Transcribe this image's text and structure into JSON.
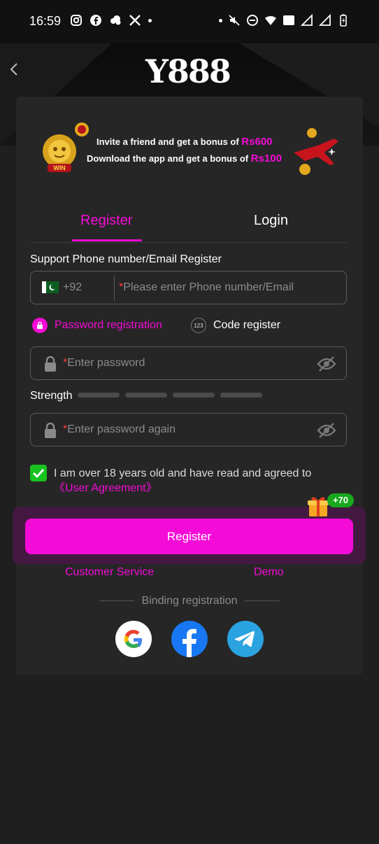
{
  "status_bar": {
    "time": "16:59"
  },
  "header": {
    "logo_text": "Y888"
  },
  "banner": {
    "line1_prefix": "Invite a friend and get a bonus of ",
    "line1_amount": "Rs600",
    "line2_prefix": "Download the app and get a bonus of ",
    "line2_amount": "Rs100",
    "lion_badge_text": "WIN"
  },
  "tabs": {
    "register": "Register",
    "login": "Login"
  },
  "form": {
    "support_label": "Support Phone number/Email Register",
    "country_code": "+92",
    "phone_placeholder": "Please enter Phone number/Email",
    "required_mark": "*",
    "option_password": "Password registration",
    "option_code": "Code register",
    "code_icon_text": "123",
    "password_placeholder": "Enter password",
    "strength_label": "Strength",
    "password_again_placeholder": "Enter password again",
    "agreement_text": "I am over 18 years old and have read and agreed to ",
    "agreement_link": "《User Agreement》",
    "agreement_checked": true
  },
  "actions": {
    "register_button": "Register",
    "bonus_badge": "+70",
    "customer_service": "Customer Service",
    "demo": "Demo"
  },
  "binding": {
    "label": "Binding registration",
    "providers": [
      "google-icon",
      "facebook-icon",
      "telegram-icon"
    ]
  },
  "colors": {
    "accent": "#f50bd7",
    "checkbox": "#18c21f",
    "card": "#262626"
  }
}
